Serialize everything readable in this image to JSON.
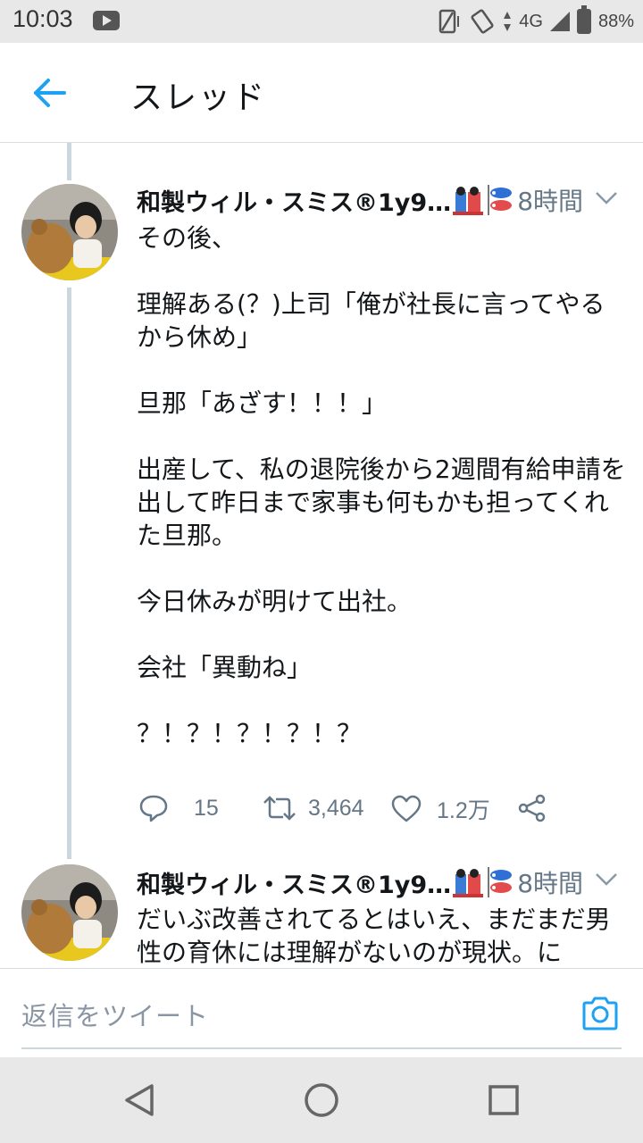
{
  "status_bar": {
    "time": "10:03",
    "network": "4G",
    "battery": "88%"
  },
  "header": {
    "title": "スレッド"
  },
  "colors": {
    "accent": "#1da1f2",
    "secondary_text": "#657786",
    "thread_line": "#ccd6dd"
  },
  "tweets": [
    {
      "author": "和製ウィル・スミス®1y9…",
      "time": "8時間",
      "text": "その後、\n\n理解ある(？)上司「俺が社長に言ってやるから休め」\n\n旦那「あざす！！！」\n\n出産して、私の退院後から2週間有給申請を出して昨日まで家事も何もかも担ってくれた旦那。\n\n今日休みが明けて出社。\n\n会社「異動ね」\n\n？！？！？！？！？",
      "replies": "15",
      "retweets": "3,464",
      "likes": "1.2万"
    },
    {
      "author": "和製ウィル・スミス®1y9…",
      "time": "8時間",
      "text": "だいぶ改善されてるとはいえ、まだまだ男性の育休には理解がないのが現状。に"
    }
  ],
  "reply_bar": {
    "placeholder": "返信をツイート"
  },
  "icons": {
    "back": "arrow-left-icon",
    "reply": "speech-bubble-icon",
    "retweet": "retweet-icon",
    "like": "heart-icon",
    "share": "share-icon",
    "camera": "camera-icon"
  }
}
